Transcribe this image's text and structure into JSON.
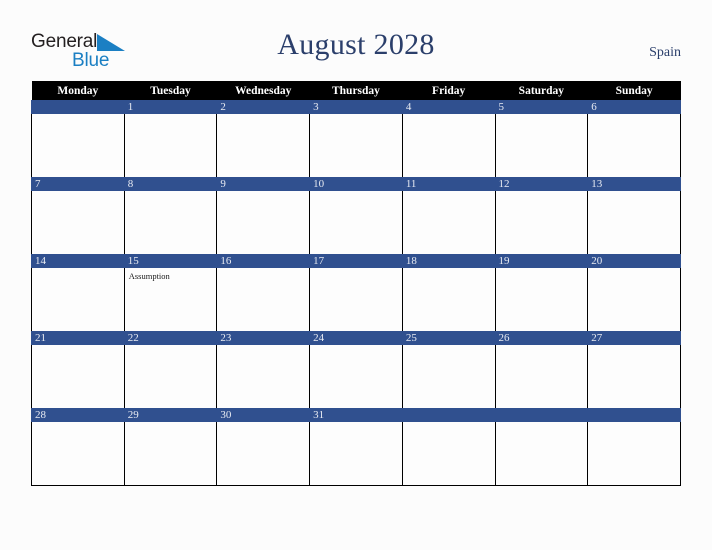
{
  "brand": {
    "logo_line1": "General",
    "logo_line2": "Blue",
    "logo_triangle_color": "#1b7fc3",
    "logo_text_color": "#231f20"
  },
  "header": {
    "title": "August 2028",
    "country": "Spain",
    "title_color": "#2b3f6b"
  },
  "theme": {
    "day_band_color": "#30508f",
    "header_row_bg": "#000000",
    "header_row_text": "#ffffff",
    "page_bg": "#fcfcfc",
    "cell_bg": "#fdfdfd",
    "grid_line_color": "#000000"
  },
  "calendar": {
    "month": "August",
    "year": "2028",
    "weekday_headers": [
      "Monday",
      "Tuesday",
      "Wednesday",
      "Thursday",
      "Friday",
      "Saturday",
      "Sunday"
    ],
    "weeks": [
      [
        {
          "day": "",
          "events": []
        },
        {
          "day": "1",
          "events": []
        },
        {
          "day": "2",
          "events": []
        },
        {
          "day": "3",
          "events": []
        },
        {
          "day": "4",
          "events": []
        },
        {
          "day": "5",
          "events": []
        },
        {
          "day": "6",
          "events": []
        }
      ],
      [
        {
          "day": "7",
          "events": []
        },
        {
          "day": "8",
          "events": []
        },
        {
          "day": "9",
          "events": []
        },
        {
          "day": "10",
          "events": []
        },
        {
          "day": "11",
          "events": []
        },
        {
          "day": "12",
          "events": []
        },
        {
          "day": "13",
          "events": []
        }
      ],
      [
        {
          "day": "14",
          "events": []
        },
        {
          "day": "15",
          "events": [
            "Assumption"
          ]
        },
        {
          "day": "16",
          "events": []
        },
        {
          "day": "17",
          "events": []
        },
        {
          "day": "18",
          "events": []
        },
        {
          "day": "19",
          "events": []
        },
        {
          "day": "20",
          "events": []
        }
      ],
      [
        {
          "day": "21",
          "events": []
        },
        {
          "day": "22",
          "events": []
        },
        {
          "day": "23",
          "events": []
        },
        {
          "day": "24",
          "events": []
        },
        {
          "day": "25",
          "events": []
        },
        {
          "day": "26",
          "events": []
        },
        {
          "day": "27",
          "events": []
        }
      ],
      [
        {
          "day": "28",
          "events": []
        },
        {
          "day": "29",
          "events": []
        },
        {
          "day": "30",
          "events": []
        },
        {
          "day": "31",
          "events": []
        },
        {
          "day": "",
          "events": []
        },
        {
          "day": "",
          "events": []
        },
        {
          "day": "",
          "events": []
        }
      ]
    ]
  }
}
